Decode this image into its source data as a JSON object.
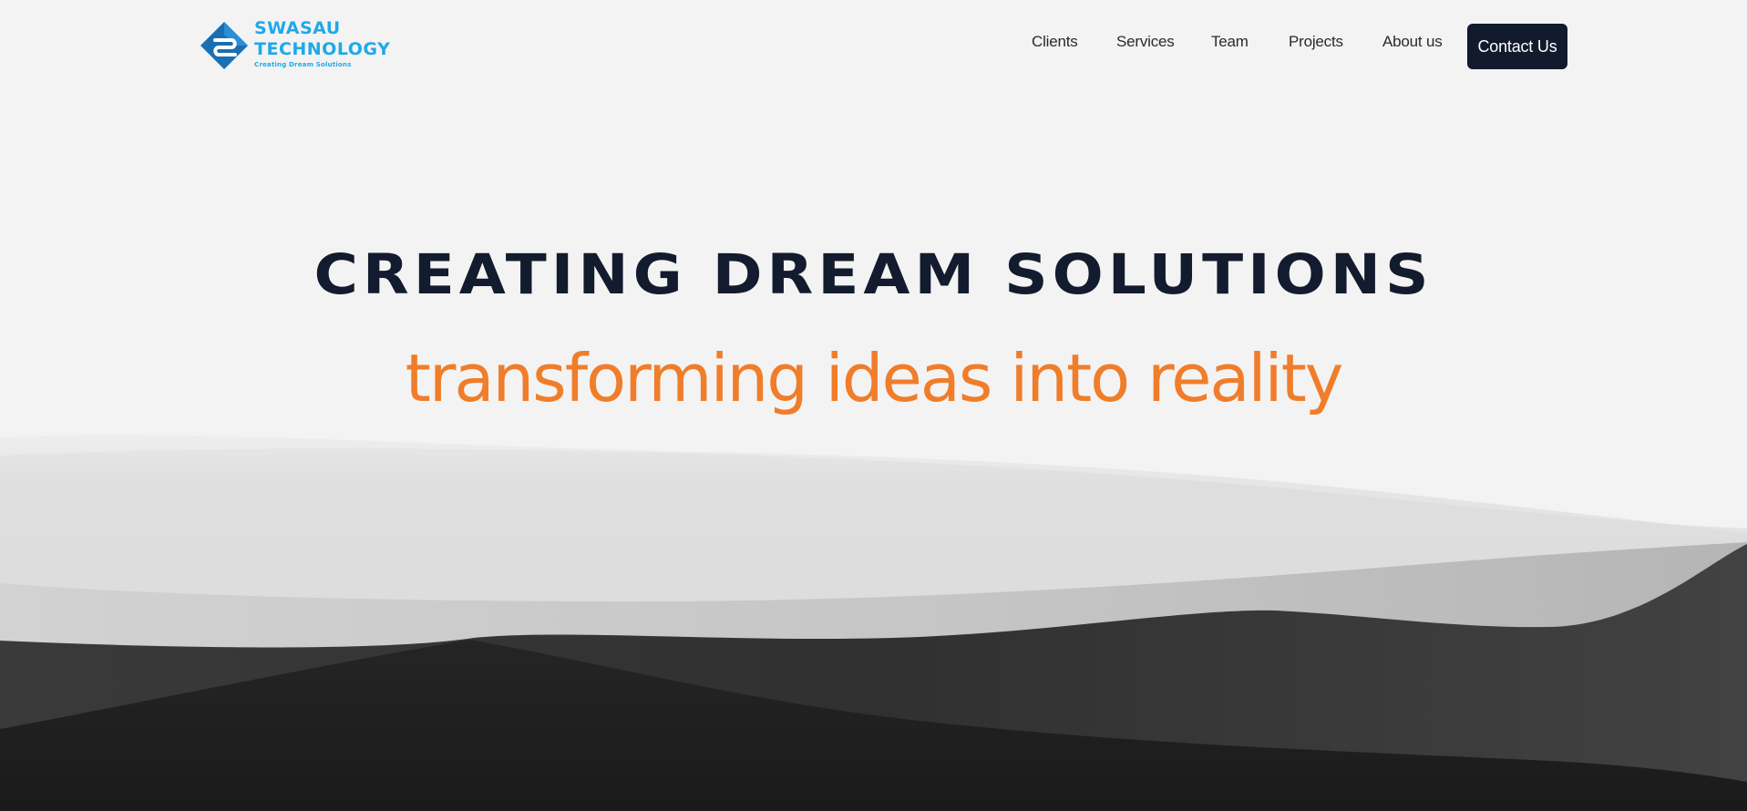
{
  "brand": {
    "name_line1": "SWASAU",
    "name_line2": "TECHNOLOGY",
    "tagline": "Creating Dream Solutions",
    "icon": "swasau-diamond-logo-icon",
    "color": "#1fa9e8"
  },
  "nav": {
    "items": [
      {
        "label": "Clients"
      },
      {
        "label": "Services"
      },
      {
        "label": "Team"
      },
      {
        "label": "Projects"
      },
      {
        "label": "About us"
      }
    ],
    "contact_label": "Contact Us"
  },
  "hero": {
    "title": "CREATING DREAM SOLUTIONS",
    "subtitle": "transforming ideas into reality",
    "title_color": "#131b2e",
    "subtitle_color": "#f07d2a"
  },
  "colors": {
    "background": "#f3f3f3",
    "button": "#121a2d",
    "hill_far": "#d9d9d9",
    "hill_mid": "#bdbdbd",
    "hill_near": "#2b2b2b",
    "hill_front": "#1c1c1c"
  }
}
